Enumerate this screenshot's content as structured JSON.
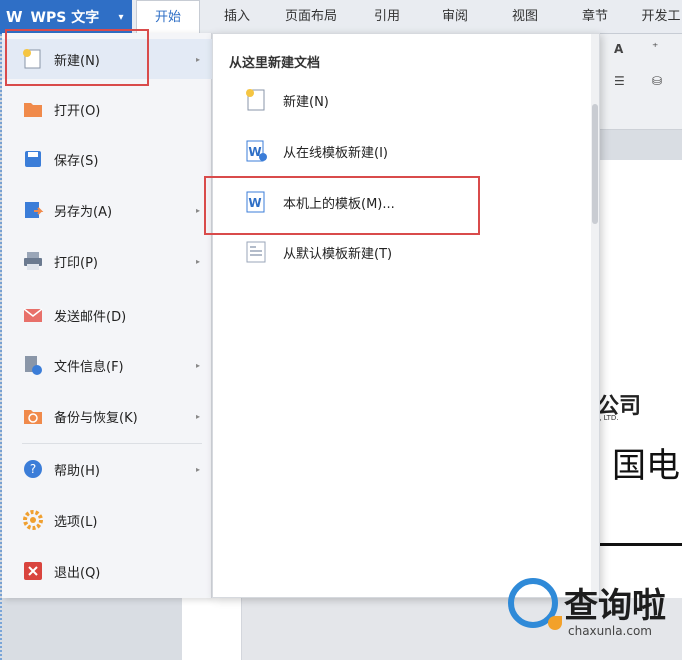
{
  "app": {
    "logo": "W",
    "name": "WPS 文字",
    "caret": "▾"
  },
  "tabs": [
    {
      "label": "开始",
      "active": true
    },
    {
      "label": "插入"
    },
    {
      "label": "页面布局"
    },
    {
      "label": "引用"
    },
    {
      "label": "审阅"
    },
    {
      "label": "视图"
    },
    {
      "label": "章节"
    },
    {
      "label": "开发工"
    }
  ],
  "menu": {
    "items": [
      {
        "label": "新建(N)",
        "icon": "new-document-icon",
        "arrow": "▸"
      },
      {
        "label": "打开(O)",
        "icon": "folder-icon"
      },
      {
        "label": "保存(S)",
        "icon": "floppy-icon"
      },
      {
        "label": "另存为(A)",
        "icon": "save-as-icon",
        "arrow": "▸"
      },
      {
        "label": "打印(P)",
        "icon": "printer-icon",
        "arrow": "▸"
      },
      {
        "label": "发送邮件(D)",
        "icon": "mail-icon"
      },
      {
        "label": "文件信息(F)",
        "icon": "file-info-icon",
        "arrow": "▸"
      },
      {
        "label": "备份与恢复(K)",
        "icon": "backup-icon",
        "arrow": "▸"
      },
      {
        "label": "帮助(H)",
        "icon": "help-icon",
        "arrow": "▸"
      },
      {
        "label": "选项(L)",
        "icon": "gear-icon"
      },
      {
        "label": "退出(Q)",
        "icon": "exit-icon"
      }
    ]
  },
  "submenu": {
    "heading": "从这里新建文档",
    "items": [
      {
        "label": "新建(N)",
        "icon": "new-blank-icon"
      },
      {
        "label": "从在线模板新建(I)",
        "icon": "online-template-icon"
      },
      {
        "label": "本机上的模板(M)...",
        "icon": "local-template-icon"
      },
      {
        "label": "从默认模板新建(T)",
        "icon": "default-template-icon"
      }
    ]
  },
  "document": {
    "company_fragment": "公司",
    "company_en_fragment": "., LTD.",
    "heading_fragment": "国电"
  },
  "toolbar_fragments": {
    "font_grow": "A",
    "format_a": "⁺",
    "list_icon": "☰",
    "paint_icon": "⛁"
  },
  "watermark": {
    "title": "查询啦",
    "url": "chaxunla.com"
  },
  "colors": {
    "accent": "#2f6fc6",
    "highlight": "#d94b4b",
    "menu_bg": "#f4f5f8"
  }
}
